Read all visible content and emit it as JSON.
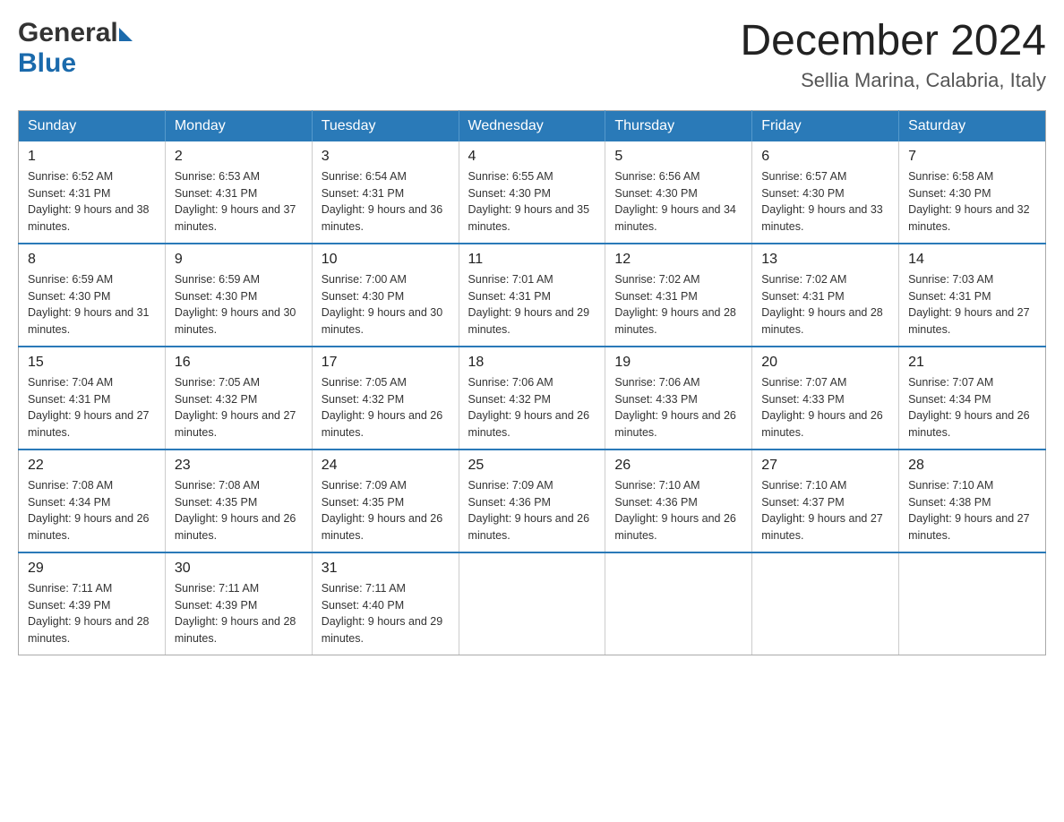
{
  "header": {
    "logo": {
      "general_text": "General",
      "blue_text": "Blue"
    },
    "month_title": "December 2024",
    "location": "Sellia Marina, Calabria, Italy"
  },
  "days_of_week": [
    "Sunday",
    "Monday",
    "Tuesday",
    "Wednesday",
    "Thursday",
    "Friday",
    "Saturday"
  ],
  "weeks": [
    [
      {
        "day": "1",
        "sunrise": "6:52 AM",
        "sunset": "4:31 PM",
        "daylight": "9 hours and 38 minutes."
      },
      {
        "day": "2",
        "sunrise": "6:53 AM",
        "sunset": "4:31 PM",
        "daylight": "9 hours and 37 minutes."
      },
      {
        "day": "3",
        "sunrise": "6:54 AM",
        "sunset": "4:31 PM",
        "daylight": "9 hours and 36 minutes."
      },
      {
        "day": "4",
        "sunrise": "6:55 AM",
        "sunset": "4:30 PM",
        "daylight": "9 hours and 35 minutes."
      },
      {
        "day": "5",
        "sunrise": "6:56 AM",
        "sunset": "4:30 PM",
        "daylight": "9 hours and 34 minutes."
      },
      {
        "day": "6",
        "sunrise": "6:57 AM",
        "sunset": "4:30 PM",
        "daylight": "9 hours and 33 minutes."
      },
      {
        "day": "7",
        "sunrise": "6:58 AM",
        "sunset": "4:30 PM",
        "daylight": "9 hours and 32 minutes."
      }
    ],
    [
      {
        "day": "8",
        "sunrise": "6:59 AM",
        "sunset": "4:30 PM",
        "daylight": "9 hours and 31 minutes."
      },
      {
        "day": "9",
        "sunrise": "6:59 AM",
        "sunset": "4:30 PM",
        "daylight": "9 hours and 30 minutes."
      },
      {
        "day": "10",
        "sunrise": "7:00 AM",
        "sunset": "4:30 PM",
        "daylight": "9 hours and 30 minutes."
      },
      {
        "day": "11",
        "sunrise": "7:01 AM",
        "sunset": "4:31 PM",
        "daylight": "9 hours and 29 minutes."
      },
      {
        "day": "12",
        "sunrise": "7:02 AM",
        "sunset": "4:31 PM",
        "daylight": "9 hours and 28 minutes."
      },
      {
        "day": "13",
        "sunrise": "7:02 AM",
        "sunset": "4:31 PM",
        "daylight": "9 hours and 28 minutes."
      },
      {
        "day": "14",
        "sunrise": "7:03 AM",
        "sunset": "4:31 PM",
        "daylight": "9 hours and 27 minutes."
      }
    ],
    [
      {
        "day": "15",
        "sunrise": "7:04 AM",
        "sunset": "4:31 PM",
        "daylight": "9 hours and 27 minutes."
      },
      {
        "day": "16",
        "sunrise": "7:05 AM",
        "sunset": "4:32 PM",
        "daylight": "9 hours and 27 minutes."
      },
      {
        "day": "17",
        "sunrise": "7:05 AM",
        "sunset": "4:32 PM",
        "daylight": "9 hours and 26 minutes."
      },
      {
        "day": "18",
        "sunrise": "7:06 AM",
        "sunset": "4:32 PM",
        "daylight": "9 hours and 26 minutes."
      },
      {
        "day": "19",
        "sunrise": "7:06 AM",
        "sunset": "4:33 PM",
        "daylight": "9 hours and 26 minutes."
      },
      {
        "day": "20",
        "sunrise": "7:07 AM",
        "sunset": "4:33 PM",
        "daylight": "9 hours and 26 minutes."
      },
      {
        "day": "21",
        "sunrise": "7:07 AM",
        "sunset": "4:34 PM",
        "daylight": "9 hours and 26 minutes."
      }
    ],
    [
      {
        "day": "22",
        "sunrise": "7:08 AM",
        "sunset": "4:34 PM",
        "daylight": "9 hours and 26 minutes."
      },
      {
        "day": "23",
        "sunrise": "7:08 AM",
        "sunset": "4:35 PM",
        "daylight": "9 hours and 26 minutes."
      },
      {
        "day": "24",
        "sunrise": "7:09 AM",
        "sunset": "4:35 PM",
        "daylight": "9 hours and 26 minutes."
      },
      {
        "day": "25",
        "sunrise": "7:09 AM",
        "sunset": "4:36 PM",
        "daylight": "9 hours and 26 minutes."
      },
      {
        "day": "26",
        "sunrise": "7:10 AM",
        "sunset": "4:36 PM",
        "daylight": "9 hours and 26 minutes."
      },
      {
        "day": "27",
        "sunrise": "7:10 AM",
        "sunset": "4:37 PM",
        "daylight": "9 hours and 27 minutes."
      },
      {
        "day": "28",
        "sunrise": "7:10 AM",
        "sunset": "4:38 PM",
        "daylight": "9 hours and 27 minutes."
      }
    ],
    [
      {
        "day": "29",
        "sunrise": "7:11 AM",
        "sunset": "4:39 PM",
        "daylight": "9 hours and 28 minutes."
      },
      {
        "day": "30",
        "sunrise": "7:11 AM",
        "sunset": "4:39 PM",
        "daylight": "9 hours and 28 minutes."
      },
      {
        "day": "31",
        "sunrise": "7:11 AM",
        "sunset": "4:40 PM",
        "daylight": "9 hours and 29 minutes."
      },
      null,
      null,
      null,
      null
    ]
  ]
}
